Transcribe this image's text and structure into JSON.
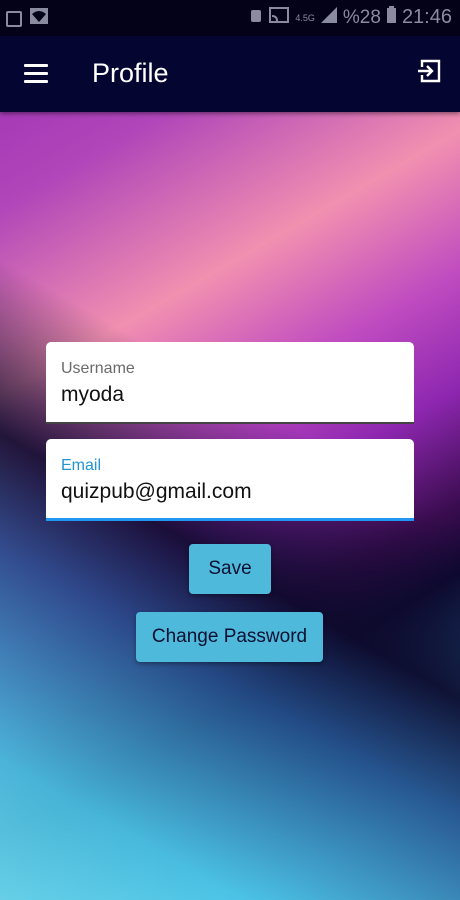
{
  "status_bar": {
    "network": "4.5G",
    "battery": "%28",
    "time": "21:46"
  },
  "app_bar": {
    "title": "Profile",
    "menu_icon": "menu-icon",
    "logout_icon": "logout-icon"
  },
  "form": {
    "username_label": "Username",
    "username_value": "myoda",
    "email_label": "Email",
    "email_value": "quizpub@gmail.com"
  },
  "buttons": {
    "save": "Save",
    "change_password": "Change Password"
  },
  "colors": {
    "app_bar": "#040530",
    "button": "#4fb9dc",
    "focus": "#2196f3"
  }
}
